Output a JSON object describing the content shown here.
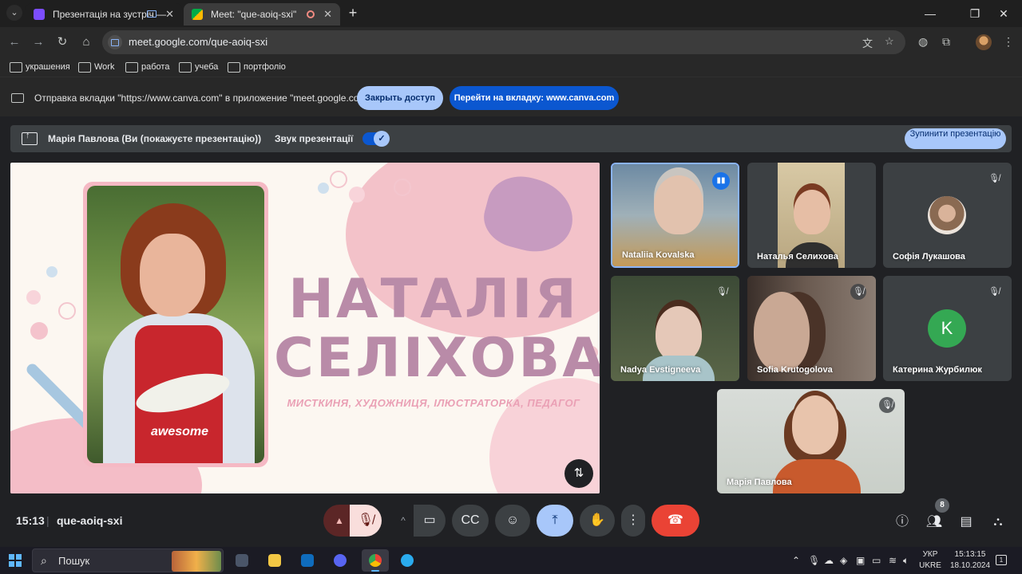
{
  "browser": {
    "tabs": [
      {
        "title": "Презентація на зустріч —",
        "active": false
      },
      {
        "title": "Meet: \"que-aoiq-sxi\"",
        "active": true
      }
    ],
    "url": "meet.google.com/que-aoiq-sxi",
    "bookmarks": [
      "украшения",
      "Work",
      "работа",
      "учеба",
      "портфоліо"
    ]
  },
  "infobar": {
    "text": "Отправка вкладки \"https://www.canva.com\" в приложение \"meet.google.com\"...",
    "close_access_label": "Закрыть доступ",
    "goto_tab_label": "Перейти на вкладку: www.canva.com"
  },
  "presenting_bar": {
    "presenter_label": "Марія Павлова (Ви (покажуєте презентацію))",
    "sound_label": "Звук презентації",
    "sound_enabled": true,
    "stop_label": "Зупинити презентацію"
  },
  "slide": {
    "title_line1": "НАТАЛІЯ",
    "title_line2": "СЕЛІХОВА",
    "subtitle": "МИСТКИНЯ, ХУДОЖНИЦЯ, ІЛЮСТРАТОРКА, ПЕДАГОГ",
    "apron_text": "awesome"
  },
  "participants": [
    {
      "name": "Nataliia Kovalska",
      "speaking": true
    },
    {
      "name": "Наталья Селихова",
      "speaking": false
    },
    {
      "name": "Софія Лукашова",
      "muted": true
    },
    {
      "name": "Nadya Evstigneeva",
      "muted": true
    },
    {
      "name": "Sofia Krutogolova",
      "muted": true
    },
    {
      "name": "Катерина Журбилюк",
      "muted": true,
      "avatar_letter": "K",
      "avatar_color": "#34a853"
    },
    {
      "name": "Марія Павлова",
      "muted": true
    }
  ],
  "meeting": {
    "time": "15:13",
    "code": "que-aoiq-sxi",
    "people_count": "8"
  },
  "taskbar": {
    "search_placeholder": "Пошук",
    "language_line1": "УКР",
    "language_line2": "UKRE",
    "clock_time": "15:13:15",
    "clock_date": "18.10.2024",
    "notifications": "1"
  }
}
